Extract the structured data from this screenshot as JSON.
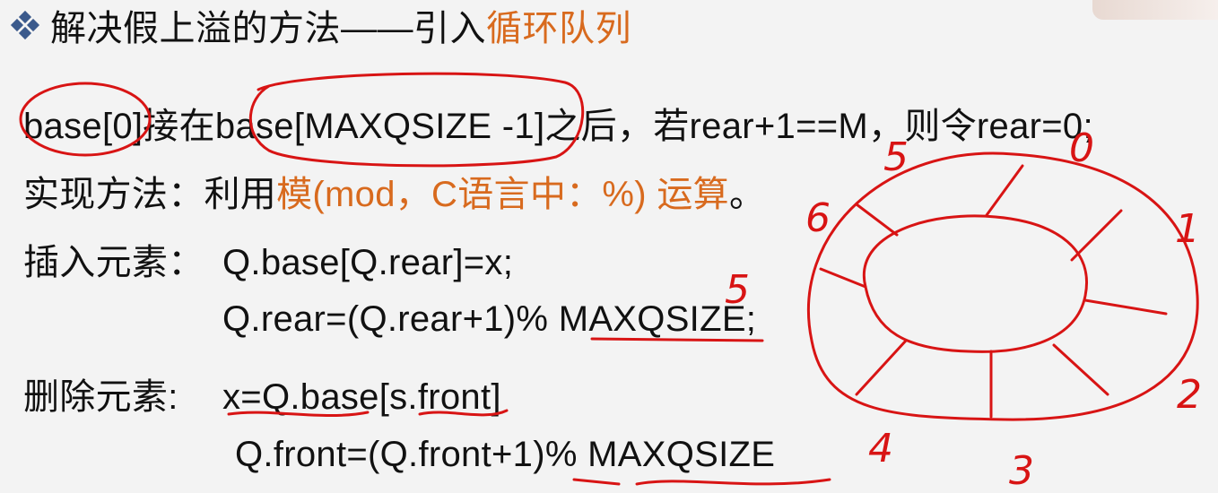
{
  "heading": {
    "prefix": "解决假上溢的方法——引入",
    "highlight": "循环队列"
  },
  "lines": {
    "line1": "base[0]接在base[MAXQSIZE -1]之后，若rear+1==M，则令rear=0;",
    "line2_prefix": "实现方法：利用",
    "line2_highlight": "模(mod，C语言中：%) 运算",
    "line2_suffix": "。",
    "insert_label": "插入元素：",
    "insert_code1": "Q.base[Q.rear]=x;",
    "insert_code2": "Q.rear=(Q.rear+1)% MAXQSIZE;",
    "delete_label": "删除元素:",
    "delete_code1": "x=Q.base[s.front]",
    "delete_code2": "Q.front=(Q.front+1)% MAXQSIZE"
  },
  "annotations": {
    "num_0": "0",
    "num_1": "1",
    "num_2": "2",
    "num_3": "3",
    "num_4": "4",
    "num_5": "5",
    "num_6": "6",
    "num_5b": "5"
  },
  "colors": {
    "background": "#f3f3f3",
    "text": "#111111",
    "highlight": "#d86a1e",
    "ink": "#d81414",
    "bullet": "#3b5a8c"
  }
}
